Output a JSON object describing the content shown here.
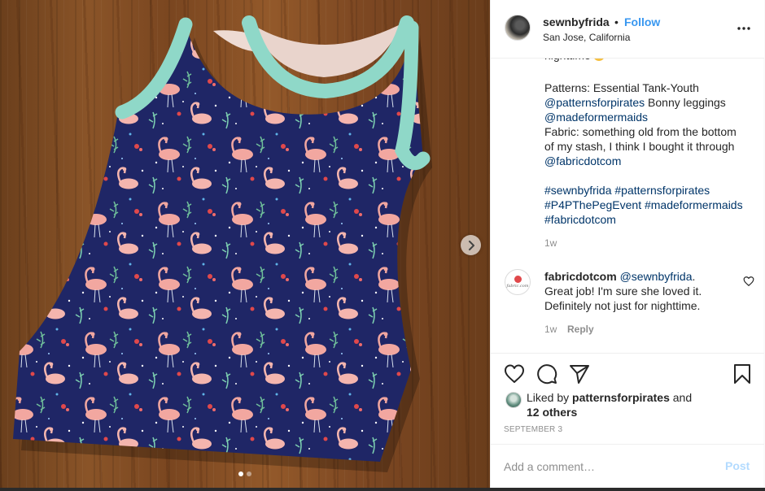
{
  "post": {
    "username": "sewnbyfrida",
    "separator": "•",
    "follow_label": "Follow",
    "location": "San Jose, California",
    "more_icon": "more-options-icon"
  },
  "caption": {
    "cut_line": "nighttime",
    "lines": [
      {
        "text": "Patterns: Essential Tank-Youth",
        "link": false
      },
      {
        "text": "@patternsforpirates",
        "link": true,
        "suffix": " Bonny leggings"
      },
      {
        "text": "@madeformermaids",
        "link": true
      },
      {
        "text": "Fabric: something old from the bottom",
        "link": false
      },
      {
        "text": "of my stash, I think I bought it through",
        "link": false
      },
      {
        "text": "@fabricdotcom",
        "link": true
      }
    ],
    "hashtags": [
      [
        "#sewnbyfrida",
        "#patternsforpirates"
      ],
      [
        "#P4PThePegEvent",
        "#madeformermaids"
      ],
      [
        "#fabricdotcom"
      ]
    ],
    "time": "1w"
  },
  "comment": {
    "avatar_text": "fabric.com",
    "username": "fabricdotcom",
    "mention": "@sewnbyfrida",
    "mention_suffix": ".",
    "line2": "Great job! I'm sure she loved it.",
    "line3": "Definitely not just for nighttime.",
    "time": "1w",
    "reply_label": "Reply"
  },
  "likes": {
    "prefix": "Liked by ",
    "user": "patternsforpirates",
    "conj": " and",
    "others": "12 others"
  },
  "date": "SEPTEMBER 3",
  "add_comment": {
    "placeholder": "Add a comment…",
    "post_label": "Post"
  },
  "carousel": {
    "count": 2,
    "active_index": 0
  },
  "colors": {
    "link": "#003569",
    "follow": "#3897f0",
    "post_disabled": "#b3dbff",
    "muted": "#8e8e8e",
    "fabric_navy": "#1f2666",
    "ribbing_mint": "#8fd8c8",
    "flamingo_pink": "#f2a7a0"
  }
}
